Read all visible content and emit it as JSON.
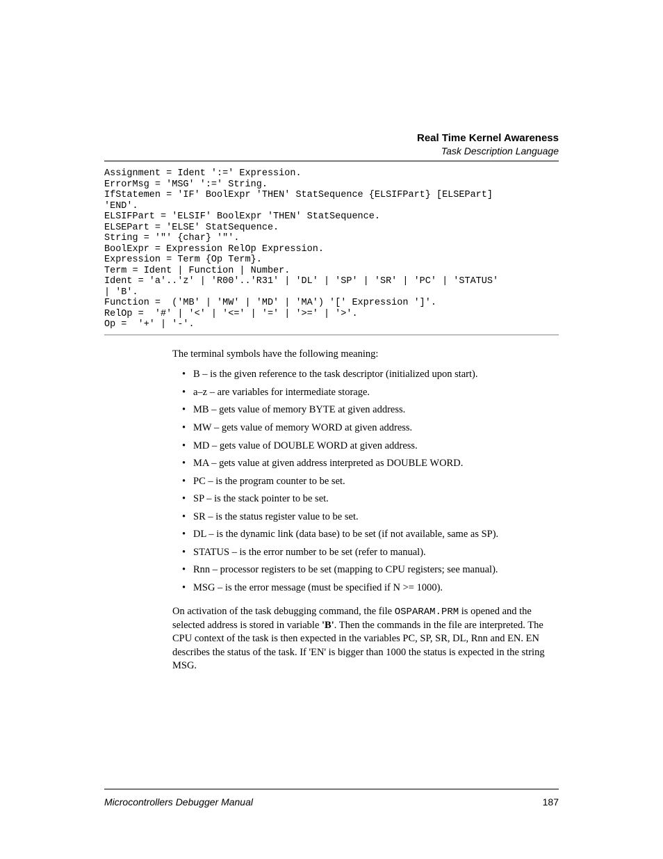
{
  "header": {
    "title": "Real Time Kernel Awareness",
    "subtitle": "Task Description Language"
  },
  "code": "Assignment = Ident ':=' Expression.\nErrorMsg = 'MSG' ':=' String.\nIfStatemen = 'IF' BoolExpr 'THEN' StatSequence {ELSIFPart} [ELSEPart] \n'END'.\nELSIFPart = 'ELSIF' BoolExpr 'THEN' StatSequence.\nELSEPart = 'ELSE' StatSequence.\nString = '\"' {char} '\"'.\nBoolExpr = Expression RelOp Expression.\nExpression = Term {Op Term}.\nTerm = Ident | Function | Number.\nIdent = 'a'..'z' | 'R00'..'R31' | 'DL' | 'SP' | 'SR' | 'PC' | 'STATUS' \n| 'B'.\nFunction =  ('MB' | 'MW' | 'MD' | 'MA') '[' Expression ']'.\nRelOp =  '#' | '<' | '<=' | '=' | '>=' | '>'.\nOp =  '+' | '-'.",
  "intro": "The terminal symbols have the following meaning:",
  "symbols": [
    "B – is the given reference to the task descriptor (initialized upon start).",
    "a–z – are variables for intermediate storage.",
    "MB – gets value of memory BYTE at given address.",
    "MW – gets value of memory WORD at given address.",
    "MD – gets value of DOUBLE WORD at given address.",
    "MA – gets value at given address interpreted as DOUBLE WORD.",
    "PC – is the program counter to be set.",
    "SP – is the stack pointer to be set.",
    "SR – is the status register value to be set.",
    "DL – is the dynamic link (data base) to be set (if not available, same as SP).",
    "STATUS – is the error number to be set (refer to manual).",
    "Rnn – processor registers to be set (mapping to CPU registers; see manual).",
    "MSG – is the error message (must be specified if N >= 1000)."
  ],
  "para": {
    "p1a": "On activation of the task debugging command, the file ",
    "p1_mono": "OSPARAM.PRM",
    "p1b": " is opened and the selected address is stored in variable ",
    "p1_bold": "'B'",
    "p1c": ". Then the commands in the file are interpreted. The CPU context of the task is then expected in the variables PC, SP, SR, DL, Rnn and EN. EN describes the status of the task. If 'EN' is bigger than 1000 the status is expected in the string MSG."
  },
  "footer": {
    "left": "Microcontrollers Debugger Manual",
    "right": "187"
  }
}
